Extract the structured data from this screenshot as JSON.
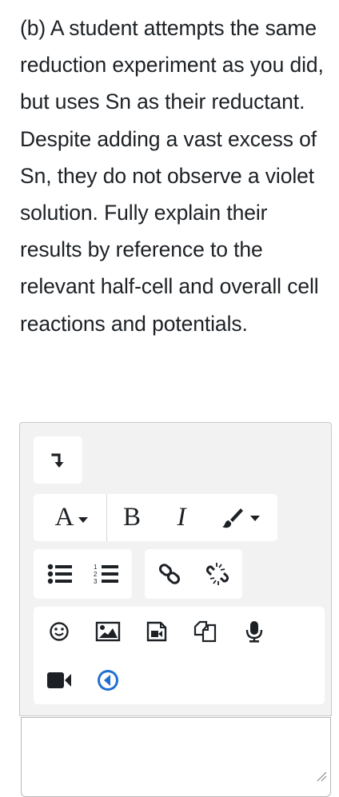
{
  "question": {
    "text": "(b) A student attempts the same reduction experiment as you did, but uses Sn as their reductant. Despite adding a vast excess of Sn, they do not observe a violet solution. Fully explain their results by reference to the relevant half-cell and overall cell reactions and potentials."
  },
  "toolbar": {
    "font_label": "A",
    "bold_label": "B",
    "italic_label": "I"
  },
  "icons": {
    "toggle": "arrow-down-right-icon",
    "font": "font-size-icon",
    "brush": "paint-brush-icon",
    "ul": "bullet-list-icon",
    "ol": "numbered-list-icon",
    "link": "link-icon",
    "unlink": "unlink-icon",
    "emoji": "smiley-icon",
    "image": "image-icon",
    "media": "media-file-icon",
    "manage": "manage-files-icon",
    "audio": "microphone-icon",
    "video": "video-camera-icon",
    "h5p": "h5p-icon"
  },
  "colors": {
    "text": "#1d2125",
    "toolbar_bg": "#f2f2f2",
    "accent_blue": "#1f6fd1"
  }
}
